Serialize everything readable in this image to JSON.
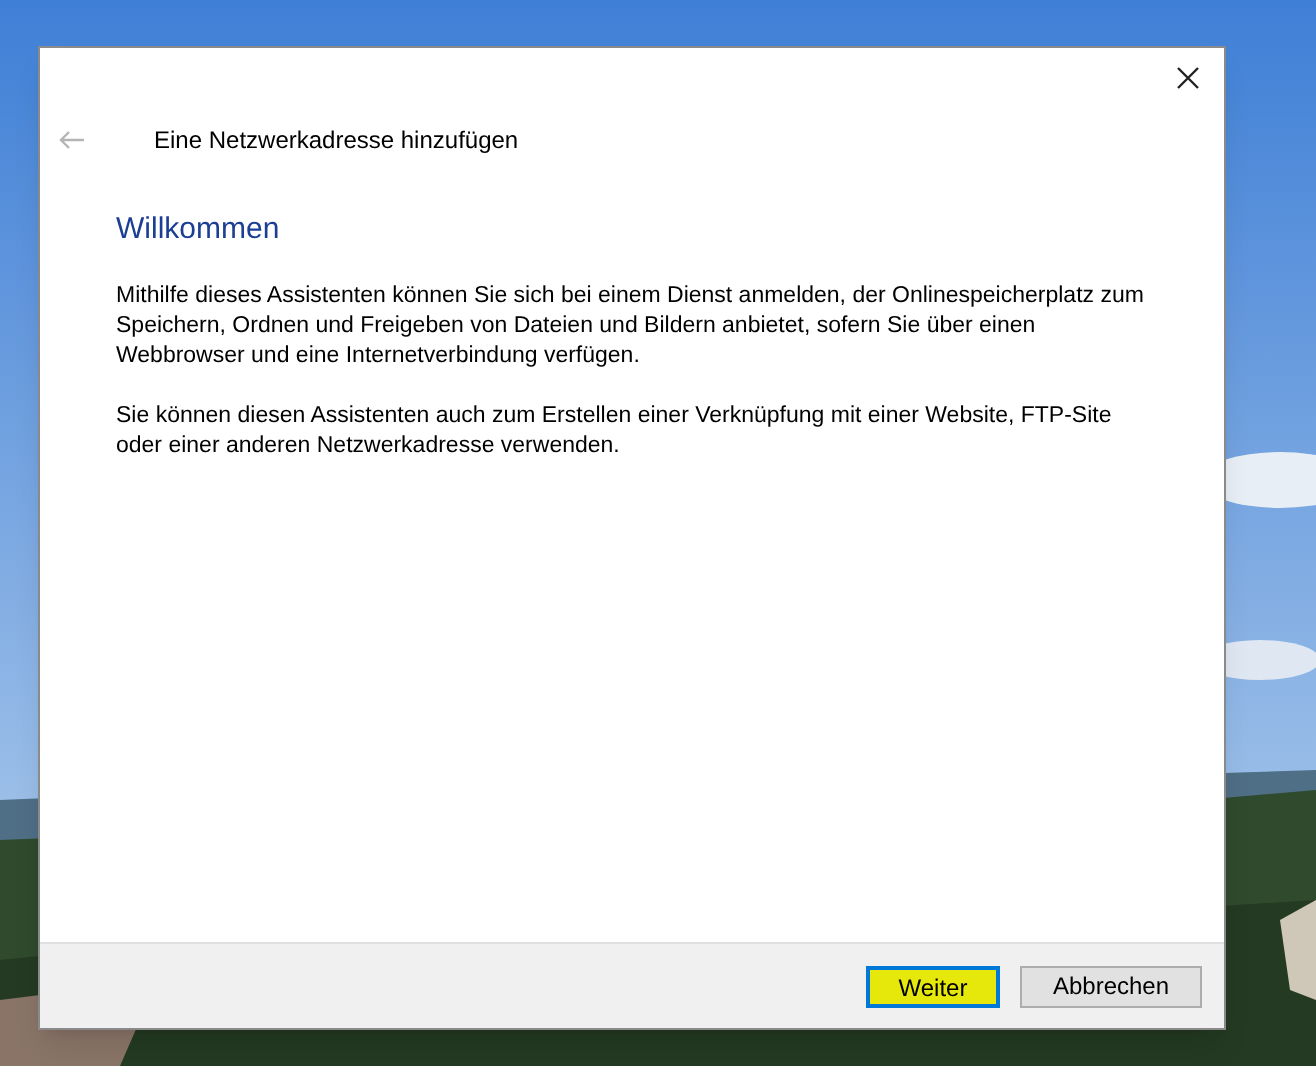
{
  "dialog": {
    "title": "Eine Netzwerkadresse hinzufügen",
    "back_enabled": false,
    "heading": "Willkommen",
    "paragraphs": [
      "Mithilfe dieses Assistenten können Sie sich bei einem Dienst anmelden, der Onlinespeicherplatz zum Speichern, Ordnen und Freigeben von Dateien und Bildern anbietet, sofern Sie über einen Webbrowser und eine Internetverbindung verfügen.",
      "Sie können diesen Assistenten auch zum Erstellen einer Verknüpfung mit einer Website, FTP-Site oder einer anderen Netzwerkadresse verwenden."
    ],
    "buttons": [
      {
        "label": "Weiter",
        "default": true,
        "highlighted": true
      },
      {
        "label": "Abbrechen",
        "default": false,
        "highlighted": false
      }
    ]
  }
}
